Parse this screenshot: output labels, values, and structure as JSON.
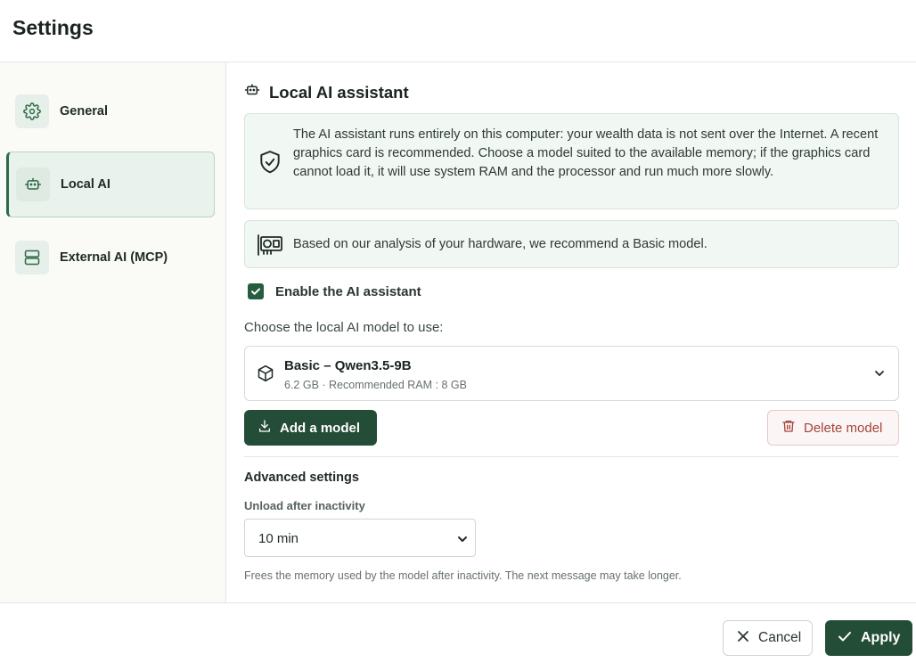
{
  "header": {
    "title": "Settings"
  },
  "sidebar": {
    "items": [
      {
        "label": "General",
        "icon": "gear-icon",
        "active": false
      },
      {
        "label": "Local AI",
        "icon": "robot-icon",
        "active": true
      },
      {
        "label": "External AI (MCP)",
        "icon": "server-icon",
        "active": false
      }
    ]
  },
  "main": {
    "section_title": "Local AI assistant",
    "section_icon": "robot-icon",
    "info_text": "The AI assistant runs entirely on this computer: your wealth data is not sent over the Internet. A recent graphics card is recommended. Choose a model suited to the available memory; if the graphics card cannot load it, it will use system RAM and the processor and run much more slowly.",
    "recommendation_text": "Based on our analysis of your hardware, we recommend a Basic model.",
    "enable_label": "Enable the AI assistant",
    "enable_checked": true,
    "choose_label": "Choose the local AI model to use:",
    "model": {
      "name": "Basic – Qwen3.5-9B",
      "meta": "6.2 GB · Recommended RAM : 8 GB"
    },
    "add_model_label": "Add a model",
    "delete_model_label": "Delete model",
    "advanced": {
      "title": "Advanced settings",
      "unload_label": "Unload after inactivity",
      "unload_value": "10 min",
      "hint": "Frees the memory used by the model after inactivity. The next message may take longer."
    }
  },
  "footer": {
    "cancel_label": "Cancel",
    "apply_label": "Apply"
  },
  "colors": {
    "accent": "#244d37",
    "accent_light": "#e9f2ec",
    "danger": "#a6433c"
  }
}
